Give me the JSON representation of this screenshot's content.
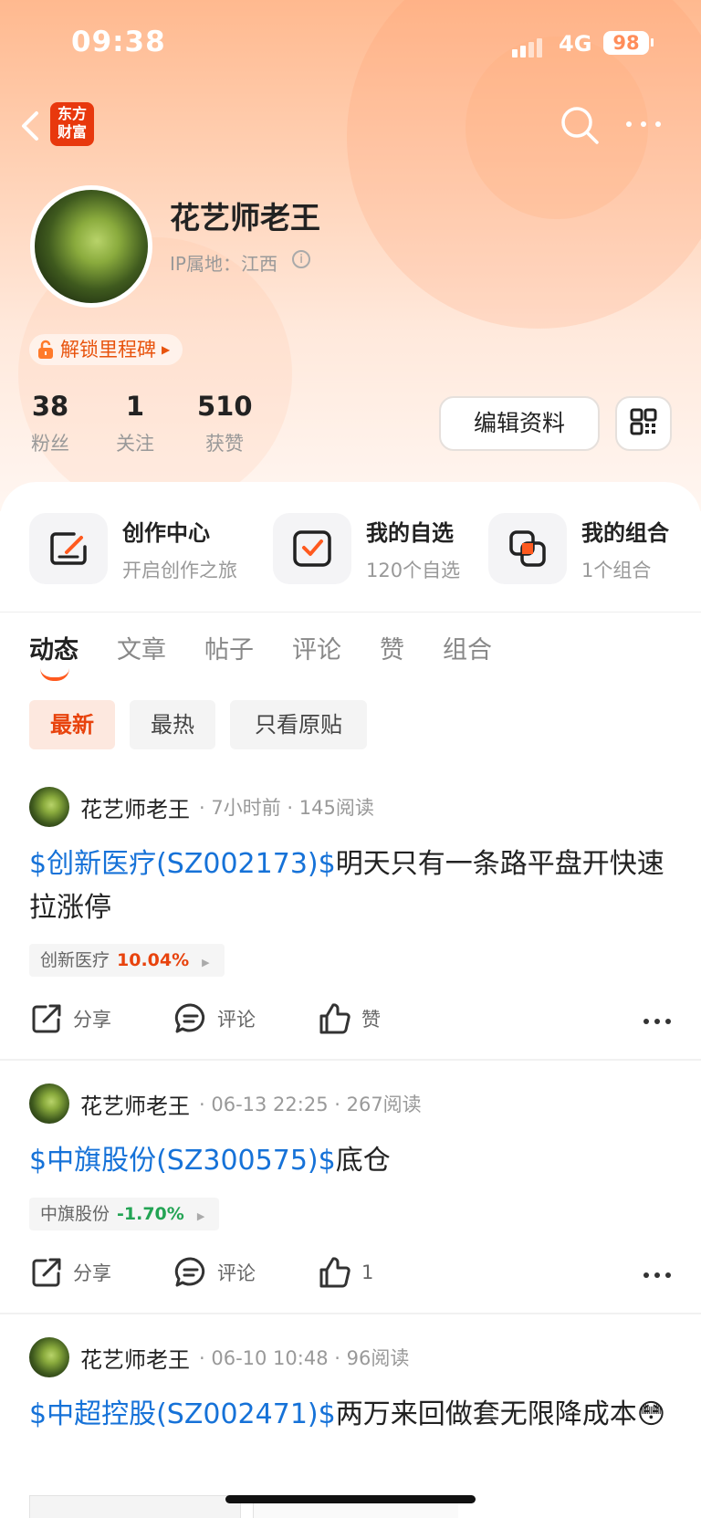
{
  "status_bar": {
    "time": "09:38",
    "network": "4G",
    "battery": "98"
  },
  "nav": {
    "logo_line1": "东方",
    "logo_line2": "财富"
  },
  "profile": {
    "name": "花艺师老王",
    "ip_location": "IP属地：江西",
    "milestone": "解锁里程碑",
    "stats": [
      {
        "value": "38",
        "label": "粉丝"
      },
      {
        "value": "1",
        "label": "关注"
      },
      {
        "value": "510",
        "label": "获赞"
      }
    ],
    "edit_button": "编辑资料"
  },
  "quick_links": [
    {
      "title": "创作中心",
      "subtitle": "开启创作之旅",
      "icon": "pen-icon"
    },
    {
      "title": "我的自选",
      "subtitle": "120个自选",
      "icon": "checkbox-icon"
    },
    {
      "title": "我的组合",
      "subtitle": "1个组合",
      "icon": "combination-icon"
    }
  ],
  "tabs": [
    "动态",
    "文章",
    "帖子",
    "评论",
    "赞",
    "组合"
  ],
  "active_tab": "动态",
  "filters": [
    "最新",
    "最热",
    "只看原贴"
  ],
  "active_filter": "最新",
  "posts": [
    {
      "author": "花艺师老王",
      "meta": "· 7小时前 · 145阅读",
      "stock_link": "$创新医疗(SZ002173)$",
      "text": "明天只有一条路平盘开快速拉涨停",
      "tag_name": "创新医疗",
      "tag_change": "10.04%",
      "share": "分享",
      "comment": "评论",
      "like": "赞"
    },
    {
      "author": "花艺师老王",
      "meta": "· 06-13 22:25 · 267阅读",
      "stock_link": "$中旗股份(SZ300575)$",
      "text": "底仓",
      "tag_name": "中旗股份",
      "tag_change": "-1.70%",
      "share": "分享",
      "comment": "评论",
      "like": "1"
    },
    {
      "author": "花艺师老王",
      "meta": "· 06-10 10:48 · 96阅读",
      "stock_link": "$中超控股(SZ002471)$",
      "text": "两万来回做套无限降成本😳"
    }
  ],
  "colors": {
    "accent": "#ff5a1f",
    "link": "#1672d8",
    "up": "#e8430d",
    "down": "#23a454"
  }
}
